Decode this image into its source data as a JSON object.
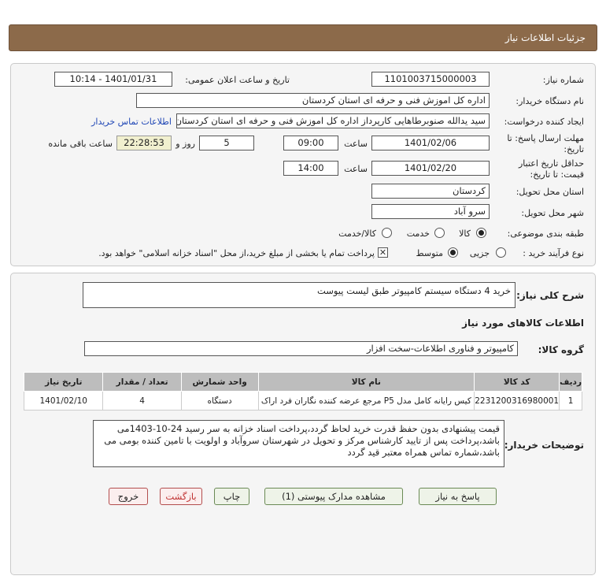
{
  "header": {
    "title": "جزئیات اطلاعات نیاز"
  },
  "form": {
    "need_number": {
      "label": "شماره نیاز:",
      "value": "1101003715000003"
    },
    "announce_date": {
      "label": "تاریخ و ساعت اعلان عمومی:",
      "value": "1401/01/31 - 10:14"
    },
    "buyer_org": {
      "label": "نام دستگاه خریدار:",
      "value": "اداره کل اموزش فنی و حرفه ای استان کردستان"
    },
    "requester": {
      "label": "ایجاد کننده درخواست:",
      "value": "سید یدالله صنوبرطاهایی کارپرداز اداره کل اموزش فنی و حرفه ای استان کردستان",
      "contact_link": "اطلاعات تماس خریدار"
    },
    "reply_deadline": {
      "label_line1": "مهلت ارسال پاسخ: تا",
      "label_line2": "تاریخ:",
      "date": "1401/02/06",
      "time_label": "ساعت",
      "time": "09:00",
      "days": "5",
      "days_label": "روز و",
      "remaining": "22:28:53",
      "remaining_label": "ساعت باقی مانده"
    },
    "price_validity": {
      "label_line1": "حداقل تاریخ اعتبار",
      "label_line2": "قیمت: تا تاریخ:",
      "date": "1401/02/20",
      "time_label": "ساعت",
      "time": "14:00"
    },
    "province": {
      "label": "استان محل تحویل:",
      "value": "کردستان"
    },
    "city": {
      "label": "شهر محل تحویل:",
      "value": "سرو آباد"
    },
    "category": {
      "label": "طبقه بندی موضوعی:",
      "options": [
        "کالا",
        "خدمت",
        "کالا/خدمت"
      ],
      "selected": "کالا"
    },
    "purchase_process": {
      "label": "نوع فرآیند خرید :",
      "options": [
        "جزیی",
        "متوسط"
      ],
      "selected": "متوسط",
      "payment_note": "پرداخت تمام یا بخشی از مبلغ خرید،از محل \"اسناد خزانه اسلامی\" خواهد بود."
    }
  },
  "details": {
    "summary_label": "شرح کلی نیاز:",
    "summary_value": "خرید 4 دستگاه سیستم کامپیوتر طبق لیست پیوست",
    "goods_info_title": "اطلاعات کالاهای مورد نیاز",
    "goods_group_label": "گروه کالا:",
    "goods_group_value": "کامپیوتر و فناوری اطلاعات-سخت افزار",
    "table": {
      "headers": [
        "ردیف",
        "کد کالا",
        "نام کالا",
        "واحد شمارش",
        "تعداد / مقدار",
        "تاریخ نیاز"
      ],
      "rows": [
        [
          "1",
          "2231200316980001",
          "کیس رایانه کامل مدل P5 مرجع عرضه کننده نگاران فرد اراک",
          "دستگاه",
          "4",
          "1401/02/10"
        ]
      ]
    },
    "buyer_notes_label": "توضیحات خریدار:",
    "buyer_notes": "قیمت پیشنهادی بدون حفظ قدرت خرید لحاظ گردد،پرداخت اسناد خزانه به سر رسید 24-10-1403می باشد،پرداخت پس از تایید کارشناس مرکز و تحویل در شهرستان سروآباد و اولویت با تامین کننده بومی می باشد،شماره تماس همراه معتبر قید گردد"
  },
  "buttons": {
    "reply": "پاسخ به نیاز",
    "view_docs": "مشاهده مدارک پیوستی (1)",
    "print": "چاپ",
    "back": "بازگشت",
    "exit": "خروج"
  }
}
